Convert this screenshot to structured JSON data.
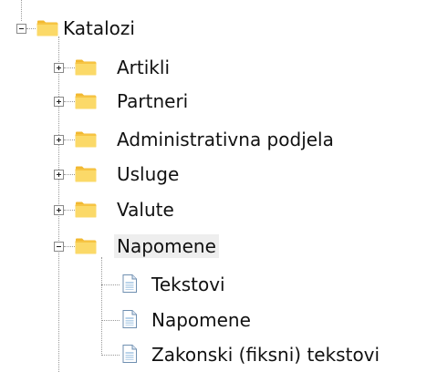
{
  "tree": {
    "root": {
      "label": "Katalozi",
      "icon": "folder-icon",
      "expanded": true,
      "children": [
        {
          "label": "Artikli",
          "icon": "folder-icon",
          "expanded": false
        },
        {
          "label": "Partneri",
          "icon": "folder-icon",
          "expanded": false
        },
        {
          "label": "Administrativna podjela",
          "icon": "folder-icon",
          "expanded": false
        },
        {
          "label": "Usluge",
          "icon": "folder-icon",
          "expanded": false
        },
        {
          "label": "Valute",
          "icon": "folder-icon",
          "expanded": false
        },
        {
          "label": "Napomene",
          "icon": "folder-icon",
          "expanded": true,
          "selected": true,
          "children": [
            {
              "label": "Tekstovi",
              "icon": "document-icon"
            },
            {
              "label": "Napomene",
              "icon": "document-icon"
            },
            {
              "label": "Zakonski (fiksni) tekstovi",
              "icon": "document-icon"
            }
          ]
        }
      ]
    }
  },
  "colors": {
    "folder_body": "#f6c443",
    "folder_tab": "#f2b830",
    "folder_front": "#fbd968",
    "selection_bg": "#eeeeee",
    "text": "#111111",
    "tree_lines": "#9a9a9a",
    "doc_blue": "#b9d3ea"
  }
}
